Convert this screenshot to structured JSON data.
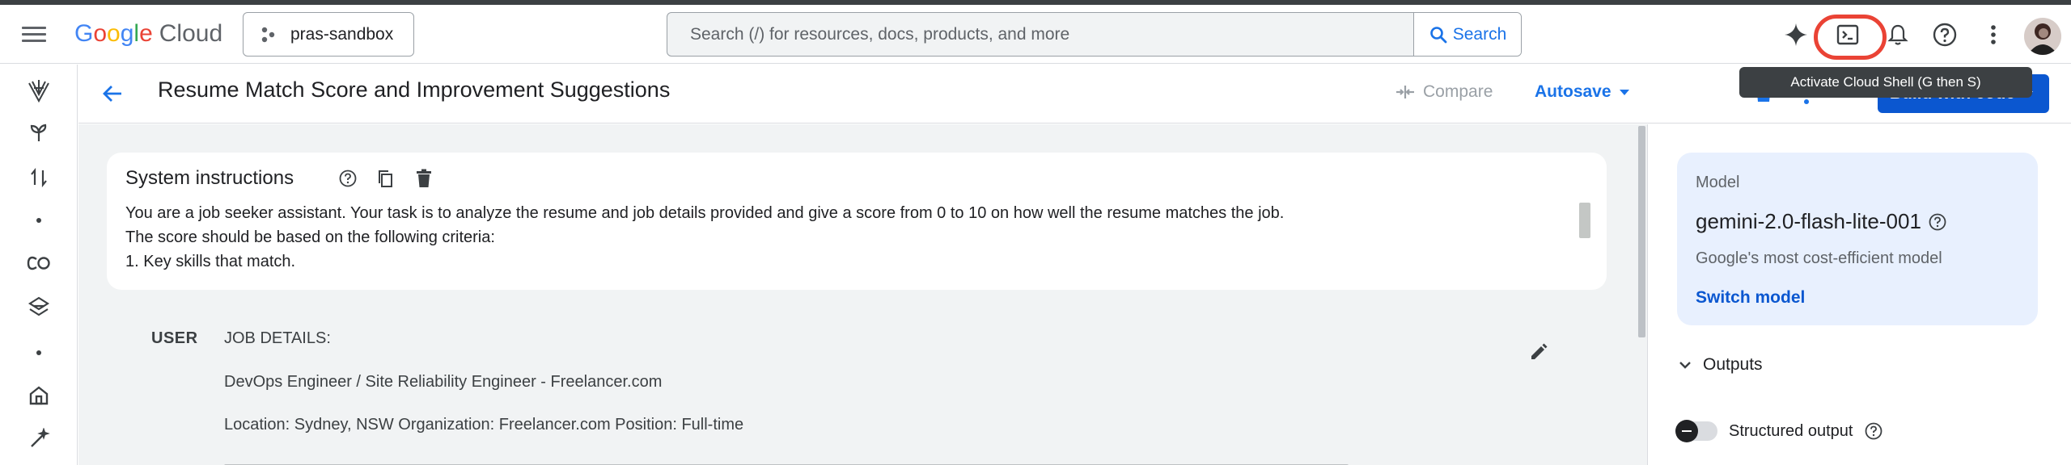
{
  "topbar": {
    "logo": {
      "google": "Google",
      "cloud": "Cloud"
    },
    "project": "pras-sandbox",
    "search": {
      "placeholder": "Search (/) for resources, docs, products, and more",
      "button": "Search"
    },
    "icons": [
      "menu-icon",
      "gemini-spark-icon",
      "cloud-shell-icon",
      "notifications-icon",
      "help-icon",
      "more-vert-icon"
    ],
    "tooltip": "Activate Cloud Shell (G then S)"
  },
  "page": {
    "title": "Resume Match Score and Improvement Suggestions",
    "actions": {
      "compare": "Compare",
      "autosave": "Autosave",
      "clear": "Clear",
      "build": "Build with code"
    }
  },
  "system": {
    "title": "System instructions",
    "lines": [
      "You are a job seeker assistant. Your task is to analyze the resume and job details provided and give a score from 0 to 10 on how well the resume matches the job.",
      "The score should be based on the following criteria:",
      "1. Key skills that match."
    ]
  },
  "user": {
    "label": "USER",
    "lines": [
      "JOB DETAILS:",
      "DevOps Engineer / Site Reliability Engineer - Freelancer.com",
      "Location: Sydney, NSW Organization: Freelancer.com Position: Full-time"
    ]
  },
  "model": {
    "label": "Model",
    "name": "gemini-2.0-flash-lite-001",
    "description": "Google's most cost-efficient model",
    "switch": "Switch model"
  },
  "outputs": {
    "label": "Outputs",
    "structured": "Structured output",
    "structured_enabled": false
  },
  "colors": {
    "accent": "#1a73e8",
    "primary_button": "#0b57d0",
    "highlight": "#ea4335",
    "model_card": "#e8f0fe"
  }
}
